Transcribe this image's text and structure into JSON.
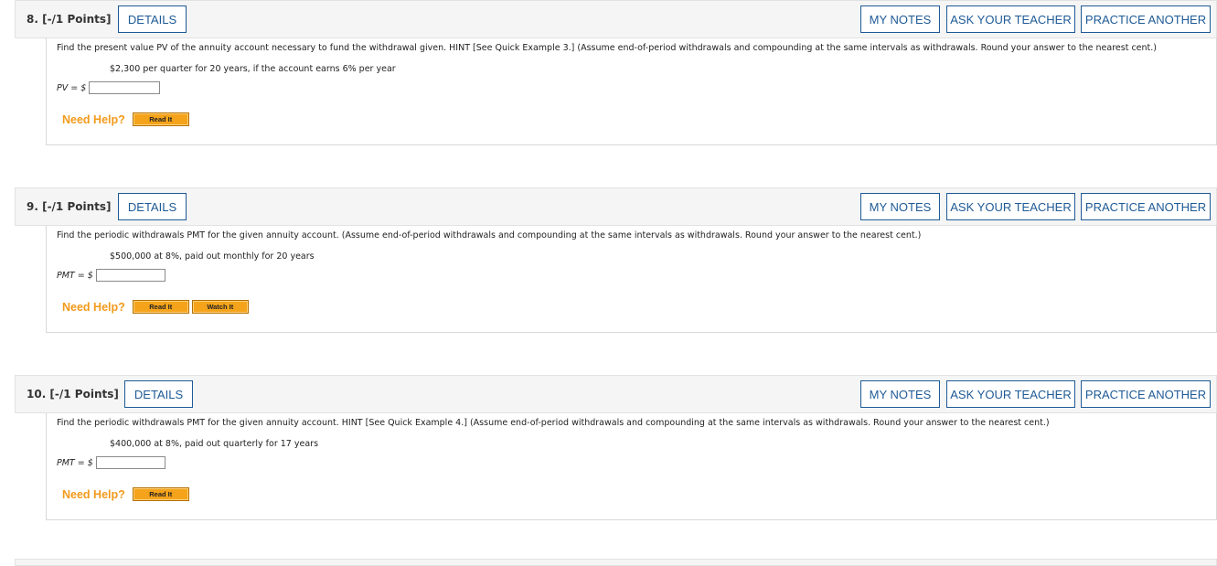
{
  "buttons": {
    "details": "DETAILS",
    "my_notes": "MY NOTES",
    "ask_teacher": "ASK YOUR TEACHER",
    "practice": "PRACTICE ANOTHER"
  },
  "need_help": "Need Help?",
  "read_it": "Read It",
  "watch_it": "Watch It",
  "questions": [
    {
      "number": "8.  [-/1 Points]",
      "prompt": "Find the present value PV of the annuity account necessary to fund the withdrawal given. HINT [See Quick Example 3.] (Assume end-of-period withdrawals and compounding at the same intervals as withdrawals. Round your answer to the nearest cent.)",
      "detail": "$2,300 per quarter for 20 years, if the account earns 6% per year",
      "answer_label": "PV = $",
      "answer_value": ""
    },
    {
      "number": "9.  [-/1 Points]",
      "prompt": "Find the periodic withdrawals PMT for the given annuity account. (Assume end-of-period withdrawals and compounding at the same intervals as withdrawals. Round your answer to the nearest cent.)",
      "detail": "$500,000 at 8%, paid out monthly for 20 years",
      "answer_label": "PMT = $",
      "answer_value": ""
    },
    {
      "number": "10.  [-/1 Points]",
      "prompt": "Find the periodic withdrawals PMT for the given annuity account. HINT [See Quick Example 4.] (Assume end-of-period withdrawals and compounding at the same intervals as withdrawals. Round your answer to the nearest cent.)",
      "detail": "$400,000 at 8%, paid out quarterly for 17 years",
      "answer_label": "PMT = $",
      "answer_value": ""
    }
  ]
}
